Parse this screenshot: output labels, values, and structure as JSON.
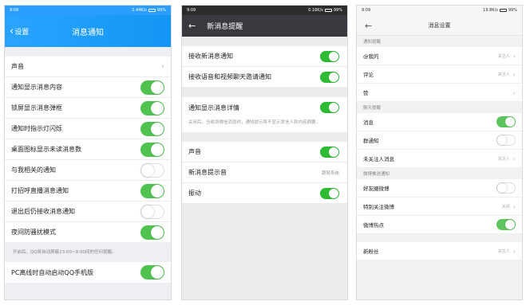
{
  "panel1": {
    "status": {
      "time": "9:09",
      "speed": "2.44K/s",
      "battery": "99%"
    },
    "back_label": "设置",
    "title": "消息通知",
    "rows": [
      {
        "label": "声音",
        "control": "arrow"
      },
      {
        "label": "通知显示消息内容",
        "control": "on"
      },
      {
        "label": "锁屏显示消息弹框",
        "control": "on"
      },
      {
        "label": "通知时指示灯闪烁",
        "control": "on"
      },
      {
        "label": "桌面图标显示未读消息数",
        "control": "on"
      },
      {
        "label": "与我相关的通知",
        "control": "off"
      },
      {
        "label": "打招呼直播消息通知",
        "control": "on"
      },
      {
        "label": "退出后仍接收消息通知",
        "control": "off"
      },
      {
        "label": "夜间防骚扰模式",
        "control": "on"
      }
    ],
    "night_note": "开启后，QQ将自动屏蔽23:00~8:00间的任何提醒。",
    "last_row": {
      "label": "PC离线时自动启动QQ手机版",
      "control": "on"
    }
  },
  "panel2": {
    "status": {
      "time": "9:09",
      "speed": "0.16K/s",
      "battery": "99%"
    },
    "title": "新消息提醒",
    "group1": [
      {
        "label": "接收新消息通知",
        "control": "on"
      },
      {
        "label": "接收语音和视频聊天邀请通知",
        "control": "on"
      }
    ],
    "detail_row": {
      "label": "通知显示消息详情",
      "control": "on"
    },
    "detail_desc": "关闭后，当收到微信消息时，通知提示将不显示发信人和内容摘要。",
    "group3": [
      {
        "label": "声音",
        "control": "on"
      },
      {
        "label": "新消息提示音",
        "value": "跟随系统"
      },
      {
        "label": "振动",
        "control": "on"
      }
    ]
  },
  "panel3": {
    "status": {
      "time": "9:09",
      "speed": "19.8K/s",
      "battery": "99%"
    },
    "title": "消息设置",
    "sections": [
      {
        "header": "通知提醒",
        "rows": [
          {
            "label": "@我的",
            "value": "关注人",
            "control": "arrow"
          },
          {
            "label": "评论",
            "value": "关注人",
            "control": "arrow"
          },
          {
            "label": "赞",
            "value": "",
            "control": "arrow"
          }
        ]
      },
      {
        "header": "聊天提醒",
        "rows": [
          {
            "label": "消息",
            "control": "on"
          },
          {
            "label": "群通知",
            "control": "off"
          },
          {
            "label": "未关注人消息",
            "value": "关注人",
            "control": "arrow"
          }
        ]
      },
      {
        "header": "微博推送通知",
        "rows": [
          {
            "label": "好友圈微博",
            "control": "off"
          },
          {
            "label": "特别关注微博",
            "value": "关闭",
            "control": "arrow"
          },
          {
            "label": "微博热点",
            "control": "on"
          }
        ]
      }
    ],
    "last_row": {
      "label": "新粉丝",
      "value": "关注人",
      "control": "arrow"
    }
  }
}
